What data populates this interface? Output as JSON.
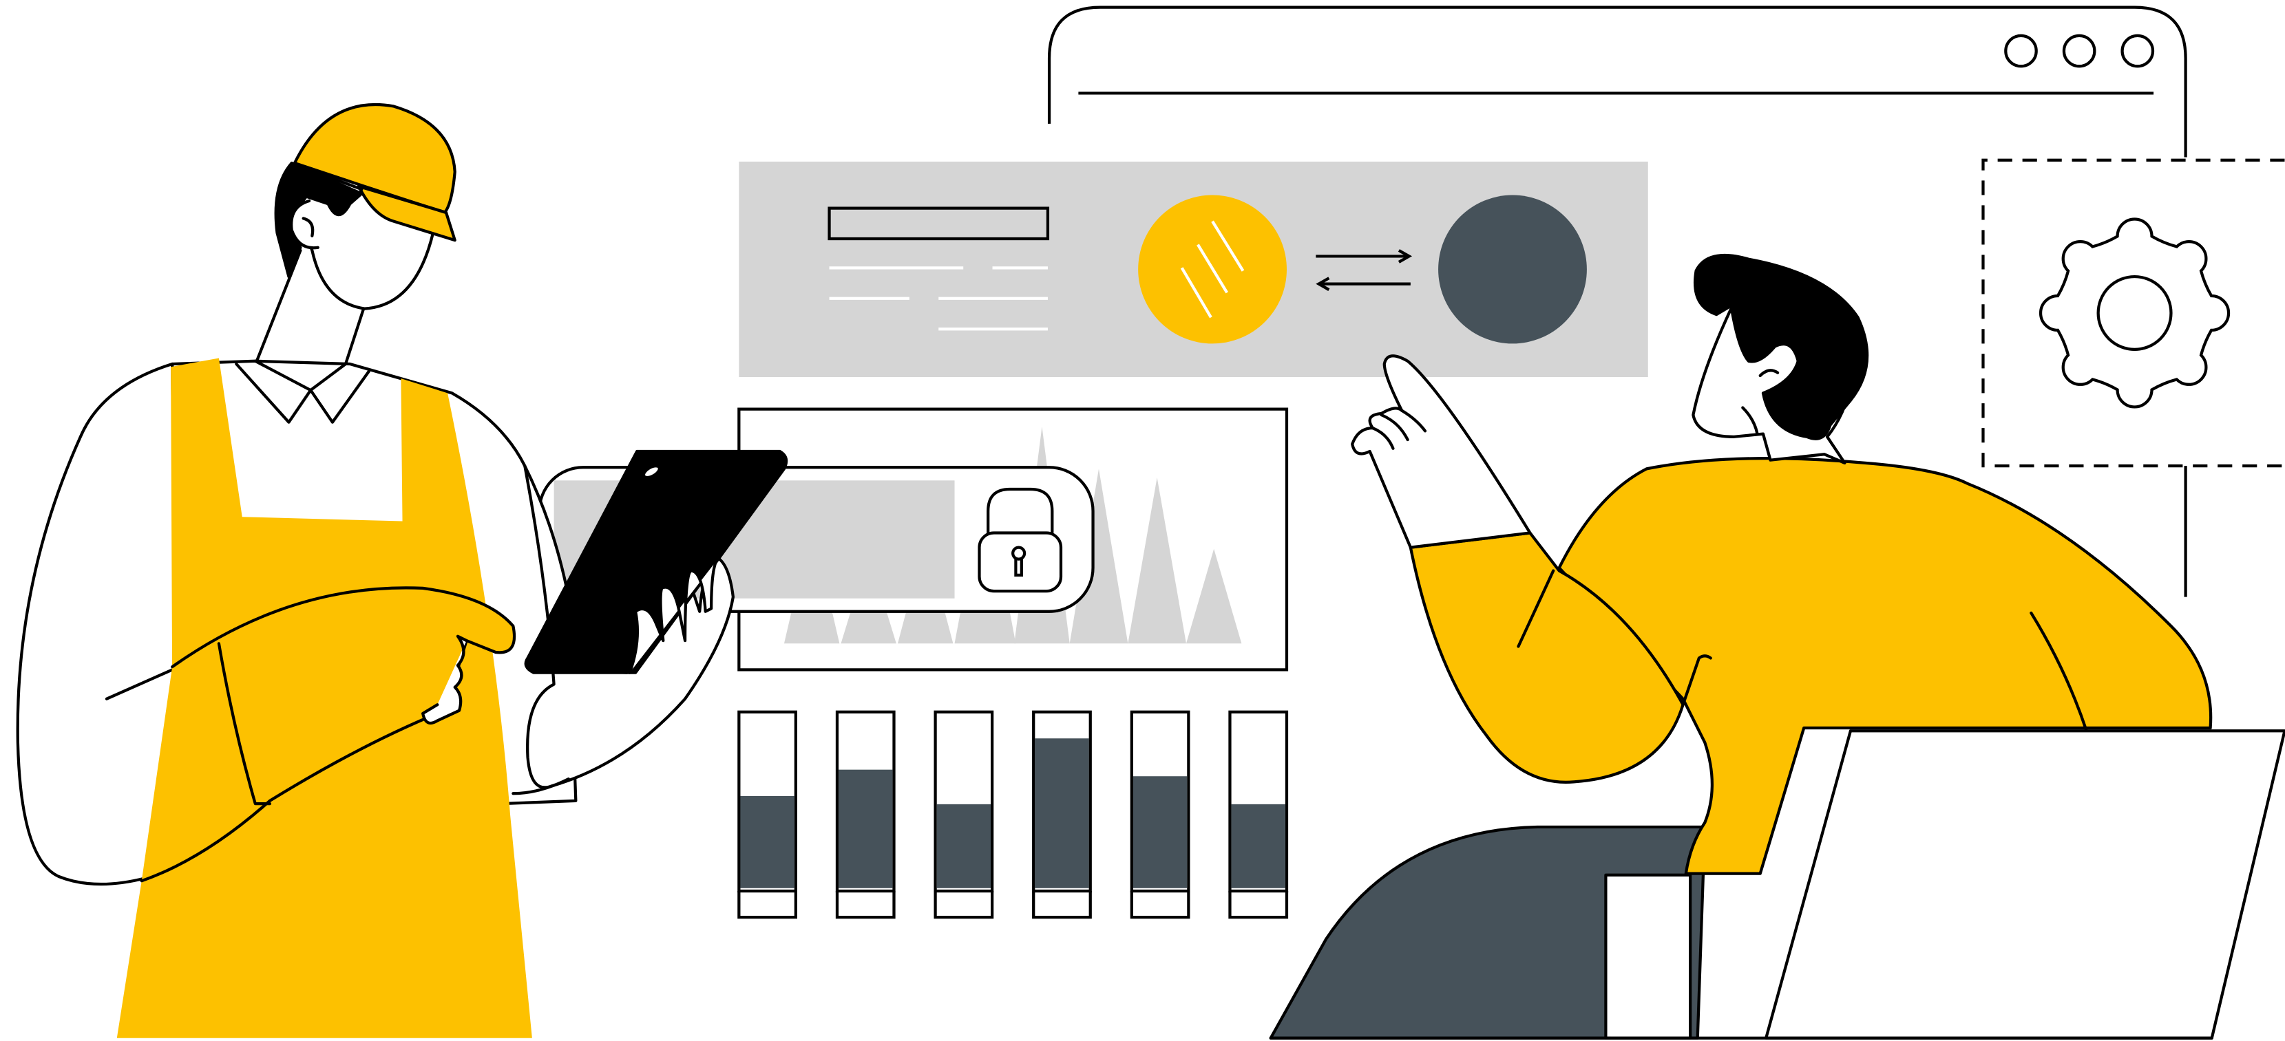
{
  "colors": {
    "accent": "#FDC100",
    "slate": "#46525A",
    "panel": "#D5D5D5",
    "ink": "#000000",
    "paper": "#FFFFFF"
  },
  "icons": [
    "window-dots-icon",
    "gear-icon",
    "padlock-icon",
    "transfer-arrows-icon",
    "tablet-device"
  ],
  "level_bars": {
    "fill_fractions": [
      0.56,
      0.72,
      0.51,
      0.91,
      0.68,
      0.51
    ]
  }
}
